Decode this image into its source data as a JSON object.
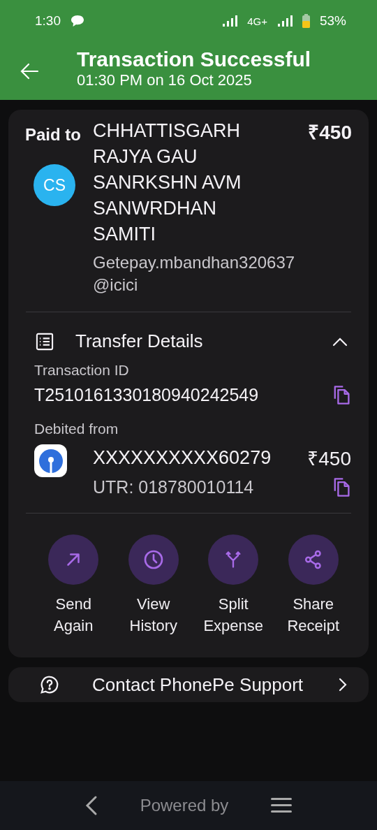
{
  "status_bar": {
    "time": "1:30",
    "battery_percent": "53%",
    "network": "4G+"
  },
  "header": {
    "title": "Transaction Successful",
    "subtitle": "01:30 PM on 16 Oct 2025"
  },
  "payee": {
    "label": "Paid to",
    "initials": "CS",
    "name": "CHHATTISGARH RAJYA GAU SANRKSHN AVM SANWRDHAN SAMITI",
    "upi_id": "Getepay.mbandhan320637@icici",
    "amount": "₹450"
  },
  "transfer_details": {
    "title": "Transfer Details",
    "expanded": true,
    "transaction_id_label": "Transaction ID",
    "transaction_id": "T2510161330180940242549",
    "debited_label": "Debited from",
    "account": "XXXXXXXXXX60279",
    "amount": "₹450",
    "utr": "UTR: 018780010114"
  },
  "actions": [
    {
      "kind": "send",
      "label": "Send Again"
    },
    {
      "kind": "history",
      "label": "View History"
    },
    {
      "kind": "split",
      "label": "Split Expense"
    },
    {
      "kind": "share",
      "label": "Share Receipt"
    }
  ],
  "support": {
    "label": "Contact PhonePe Support"
  },
  "footer": {
    "text": "Powered by"
  }
}
